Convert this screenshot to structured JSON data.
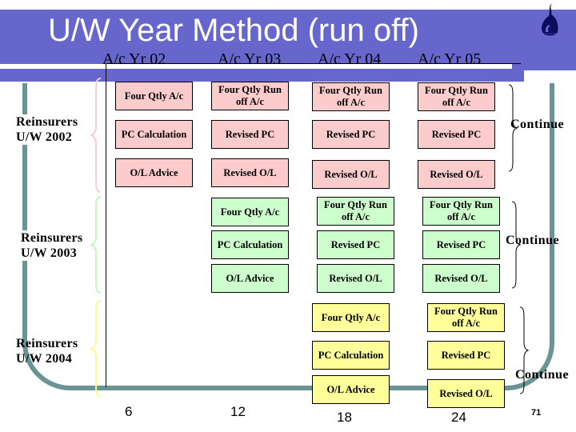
{
  "title": "U/W Year Method (run off)",
  "logo_icon": "flame-logo-icon",
  "column_headers": [
    "A/c Yr 02",
    "A/c Yr 03",
    "A/c Yr 04",
    "A/c Yr 05"
  ],
  "colors": {
    "header_band": "#6666cc",
    "frame": "#6a9494",
    "uw2002_box": "#fccccc",
    "uw2003_box": "#ccffcc",
    "uw2004_box": "#ffff99",
    "uw2002_brace": "#f4d0d0",
    "uw2003_brace": "#c8f4c8",
    "uw2004_brace": "#fafa90"
  },
  "groups": [
    {
      "label_line1": "Reinsurers",
      "label_line2": "U/W 2002",
      "continue_label": "Continue",
      "columns": [
        [
          "Four Qtly A/c",
          "PC Calculation",
          "O/L Advice"
        ],
        [
          "Four Qtly Run off A/c",
          "Revised PC",
          "Revised O/L"
        ],
        [
          "Four Qtly Run off A/c",
          "Revised PC",
          "Revised O/L"
        ],
        [
          "Four Qtly Run off A/c",
          "Revised PC",
          "Revised O/L"
        ]
      ]
    },
    {
      "label_line1": "Reinsurers",
      "label_line2": "U/W 2003",
      "continue_label": "Continue",
      "columns": [
        [
          "Four Qtly A/c",
          "PC Calculation",
          "O/L Advice"
        ],
        [
          "Four Qtly Run off A/c",
          "Revised PC",
          "Revised O/L"
        ],
        [
          "Four Qtly Run off A/c",
          "Revised PC",
          "Revised O/L"
        ]
      ]
    },
    {
      "label_line1": "Reinsurers",
      "label_line2": "U/W 2004",
      "continue_label": "Continue",
      "columns": [
        [
          "Four Qtly A/c",
          "PC Calculation",
          "O/L Advice"
        ],
        [
          "Four Qtly Run off A/c",
          "Revised PC",
          "Revised O/L"
        ]
      ]
    }
  ],
  "x_axis_ticks": [
    "6",
    "12",
    "18",
    "24"
  ],
  "page_number": "71"
}
